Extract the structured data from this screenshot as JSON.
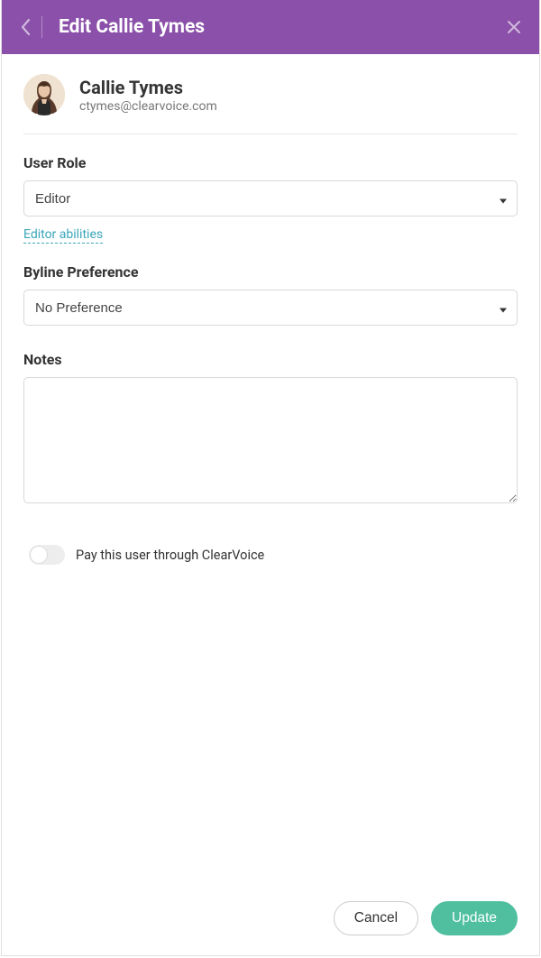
{
  "header": {
    "title": "Edit Callie Tymes"
  },
  "user": {
    "name": "Callie Tymes",
    "email": "ctymes@clearvoice.com"
  },
  "form": {
    "role_label": "User Role",
    "role_value": "Editor",
    "role_link": "Editor abilities",
    "byline_label": "Byline Preference",
    "byline_value": "No Preference",
    "notes_label": "Notes",
    "notes_value": "",
    "pay_toggle_label": "Pay this user through ClearVoice",
    "pay_toggle_on": false
  },
  "footer": {
    "cancel_label": "Cancel",
    "update_label": "Update"
  },
  "colors": {
    "header_bg": "#8b50a9",
    "primary_btn": "#4fbf9f",
    "link": "#3aa6b9"
  }
}
